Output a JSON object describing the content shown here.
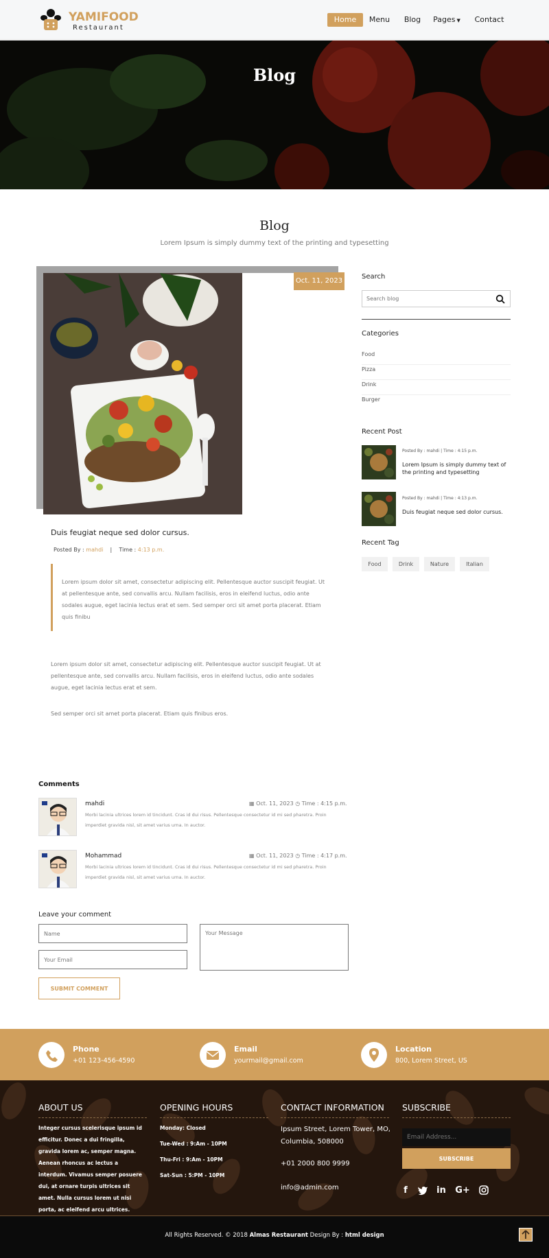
{
  "brand": {
    "name": "YAMIFOOD",
    "sub": "Restaurant"
  },
  "nav": {
    "home": "Home",
    "menu": "Menu",
    "blog": "Blog",
    "pages": "Pages",
    "contact": "Contact"
  },
  "hero": {
    "title": "Blog"
  },
  "section": {
    "title": "Blog",
    "subtitle": "Lorem Ipsum is simply dummy text of the printing and typesetting"
  },
  "post": {
    "date": "Oct. 11, 2023",
    "title": "Duis feugiat neque sed dolor cursus.",
    "posted_by_label": "Posted By :",
    "author": "mahdi",
    "sep": "|",
    "time_label": "Time :",
    "time": "4:13 p.m.",
    "quote": "Lorem ipsum dolor sit amet, consectetur adipiscing elit. Pellentesque auctor suscipit feugiat. Ut at pellentesque ante, sed convallis arcu. Nullam facilisis, eros in eleifend luctus, odio ante sodales augue, eget lacinia lectus erat et sem. Sed semper orci sit amet porta placerat. Etiam quis finibu",
    "para1": "Lorem ipsum dolor sit amet, consectetur adipiscing elit. Pellentesque auctor suscipit feugiat. Ut at pellentesque ante, sed convallis arcu. Nullam facilisis, eros in eleifend luctus, odio ante sodales augue, eget lacinia lectus erat et sem.",
    "para2": "Sed semper orci sit amet porta placerat. Etiam quis finibus eros."
  },
  "sidebar": {
    "search_heading": "Search",
    "search_placeholder": "Search blog",
    "categories_heading": "Categories",
    "categories": [
      "Food",
      "Pizza",
      "Drink",
      "Burger"
    ],
    "recent_heading": "Recent Post",
    "recent": [
      {
        "meta": "Posted By : mahdi | Time : 4:15 p.m.",
        "title": "Lorem Ipsum is simply dummy text of the printing and typesetting"
      },
      {
        "meta": "Posted By : mahdi | Time : 4:13 p.m.",
        "title": "Duis feugiat neque sed dolor cursus."
      }
    ],
    "tags_heading": "Recent Tag",
    "tags": [
      "Food",
      "Drink",
      "Nature",
      "Italian"
    ]
  },
  "comments": {
    "heading": "Comments",
    "items": [
      {
        "name": "mahdi",
        "date": "Oct. 11, 2023",
        "time": "Time : 4:15 p.m.",
        "body": "Morbi lacinia ultrices lorem id tincidunt. Cras id dui risus. Pellentesque consectetur id mi sed pharetra. Proin imperdiet gravida nisl, sit amet varius urna. In auctor."
      },
      {
        "name": "Mohammad",
        "date": "Oct. 11, 2023",
        "time": "Time : 4:17 p.m.",
        "body": "Morbi lacinia ultrices lorem id tincidunt. Cras id dui risus. Pellentesque consectetur id mi sed pharetra. Proin imperdiet gravida nisl, sit amet varius urna. In auctor."
      }
    ]
  },
  "comment_form": {
    "heading": "Leave your comment",
    "name_placeholder": "Name",
    "email_placeholder": "Your Email",
    "message_placeholder": "Your Message",
    "submit": "SUBMIT COMMENT"
  },
  "contact_strip": [
    {
      "label": "Phone",
      "value": "+01 123-456-4590"
    },
    {
      "label": "Email",
      "value": "yourmail@gmail.com"
    },
    {
      "label": "Location",
      "value": "800, Lorem Street, US"
    }
  ],
  "footer": {
    "about_heading": "ABOUT US",
    "about_text": "Integer cursus scelerisque ipsum id efficitur. Donec a dui fringilla, gravida lorem ac, semper magna. Aenean rhoncus ac lectus a interdum. Vivamus semper posuere dui, at ornare turpis ultrices sit amet. Nulla cursus lorem ut nisi porta, ac eleifend arcu ultrices.",
    "hours_heading": "OPENING HOURS",
    "hours": [
      "Monday: Closed",
      "Tue-Wed : 9:Am - 10PM",
      "Thu-Fri : 9:Am - 10PM",
      "Sat-Sun : 5:PM - 10PM"
    ],
    "contact_heading": "CONTACT INFORMATION",
    "address": "Ipsum Street, Lorem Tower, MO, Columbia, 508000",
    "phone": "+01 2000 800 9999",
    "email": "info@admin.com",
    "subscribe_heading": "SUBSCRIBE",
    "subscribe_placeholder": "Email Address...",
    "subscribe_button": "SUBSCRIBE",
    "social": [
      "f",
      "t",
      "in",
      "G+",
      "ig"
    ],
    "copyright_pre": "All Rights Reserved. © 2018",
    "copyright_brand": "Almas Restaurant",
    "copyright_mid": "Design By :",
    "copyright_design": "html design"
  },
  "colors": {
    "accent": "#d1a05d",
    "dark": "#2a1a12"
  }
}
